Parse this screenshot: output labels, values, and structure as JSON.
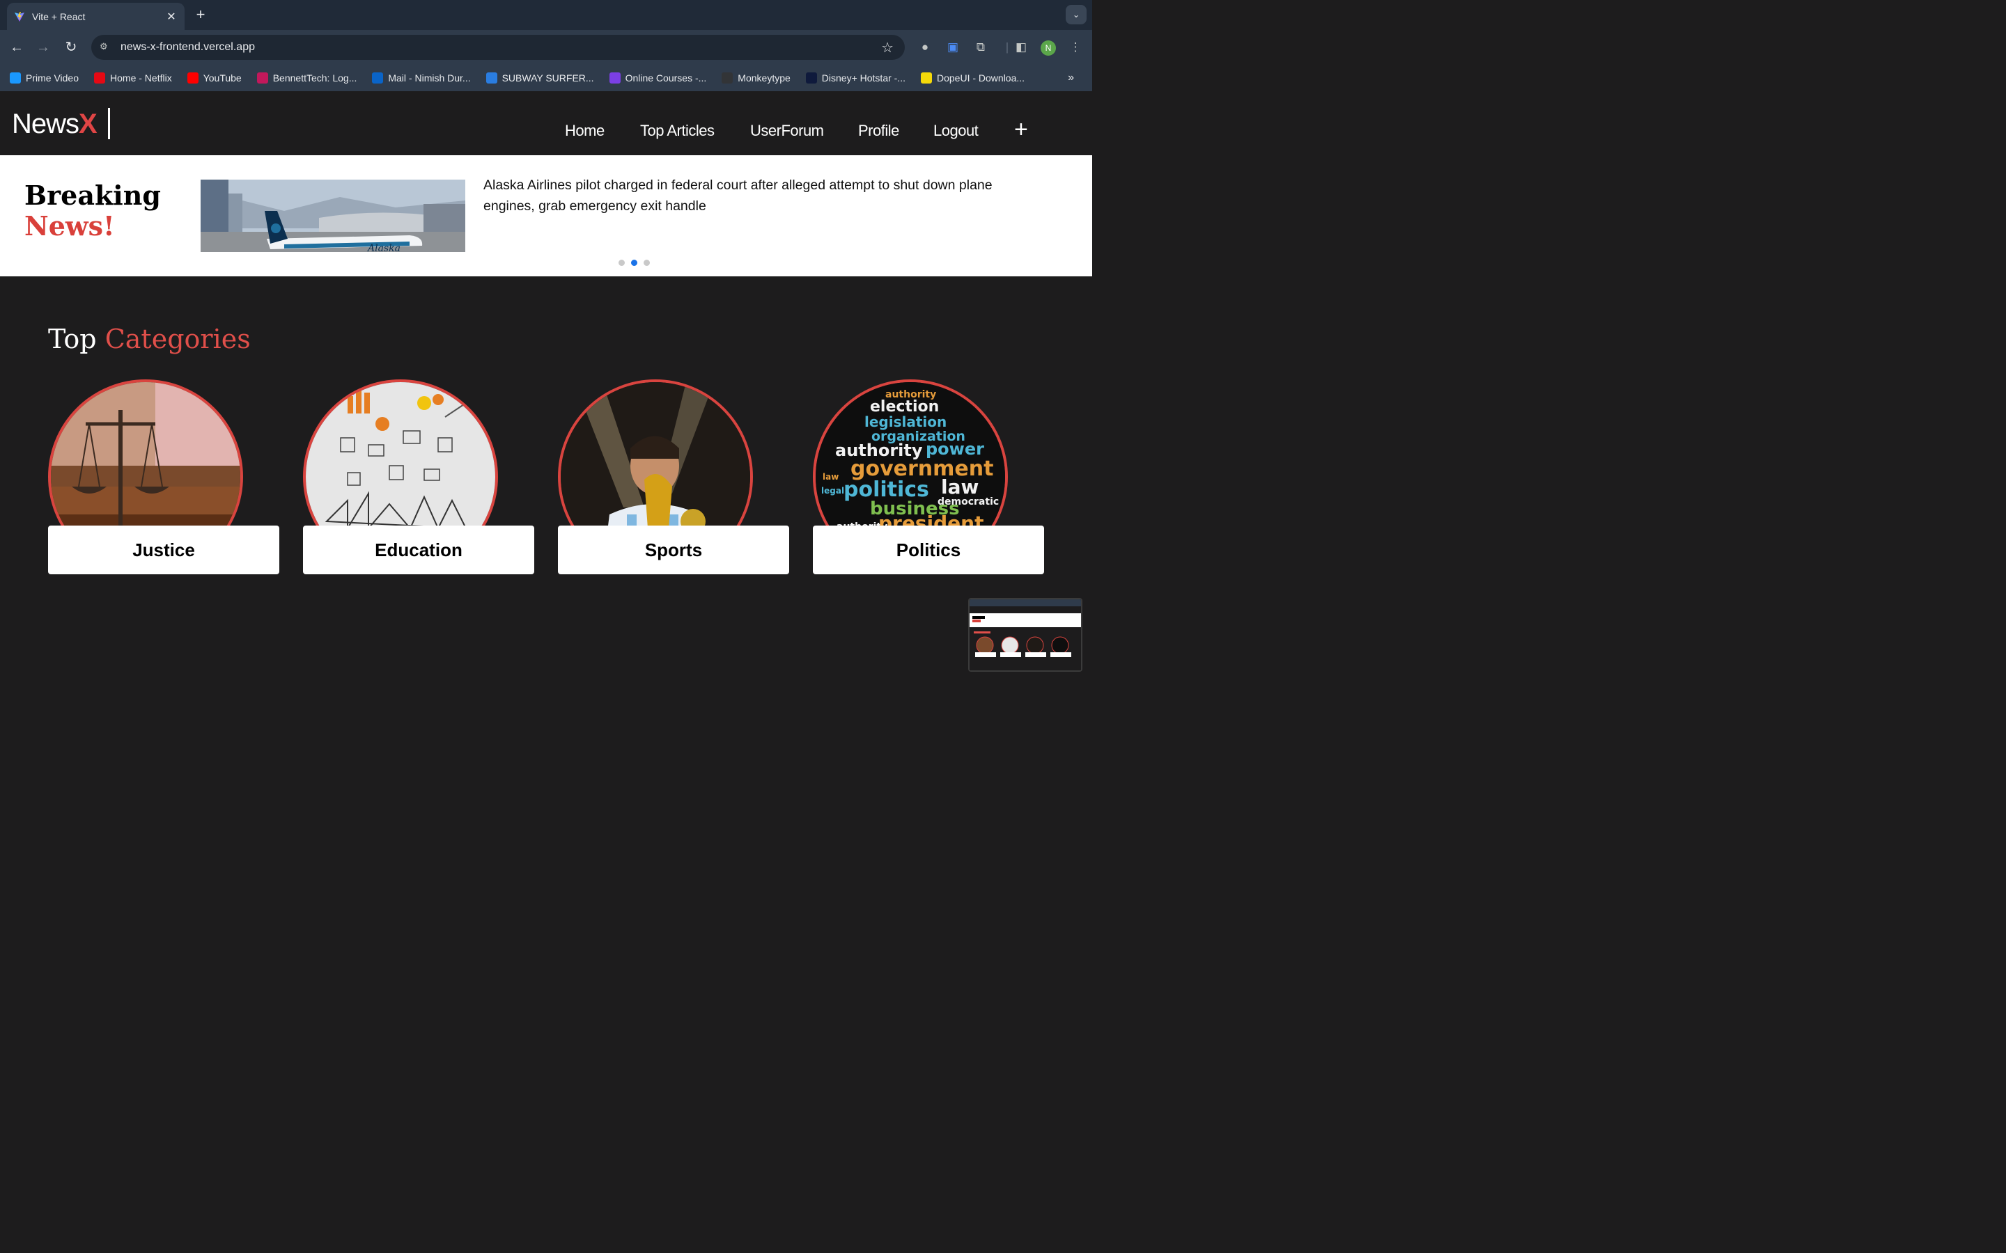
{
  "browser": {
    "tab_title": "Vite + React",
    "tab_close": "✕",
    "new_tab": "+",
    "url": "news-x-frontend.vercel.app",
    "profile_initial": "N",
    "bookmarks": [
      {
        "label": "Prime Video",
        "icon_color": "#1a98ff"
      },
      {
        "label": "Home - Netflix",
        "icon_color": "#e50914"
      },
      {
        "label": "YouTube",
        "icon_color": "#ff0000"
      },
      {
        "label": "BennettTech: Log...",
        "icon_color": "#c2185b"
      },
      {
        "label": "Mail - Nimish Dur...",
        "icon_color": "#0a64c8"
      },
      {
        "label": "SUBWAY SURFER...",
        "icon_color": "#2a7de1"
      },
      {
        "label": "Online Courses -...",
        "icon_color": "#7b3fe4"
      },
      {
        "label": "Monkeytype",
        "icon_color": "#323437"
      },
      {
        "label": "Disney+ Hotstar -...",
        "icon_color": "#0f1a3c"
      },
      {
        "label": "DopeUI - Downloa...",
        "icon_color": "#f5d90a"
      }
    ]
  },
  "site": {
    "logo_main": "News",
    "logo_accent": "X",
    "nav": [
      "Home",
      "Top Articles",
      "UserForum",
      "Profile",
      "Logout"
    ],
    "plus": "+"
  },
  "breaking": {
    "line1": "Breaking",
    "line2": "News!",
    "headline": "Alaska Airlines pilot charged in federal court after alleged attempt to shut down plane engines, grab emergency exit handle",
    "active_slide": 2,
    "slide_count": 3
  },
  "categories": {
    "heading_part1": "Top",
    "heading_part2": "Categories",
    "items": [
      "Justice",
      "Education",
      "Sports",
      "Politics"
    ]
  },
  "colors": {
    "accent_red": "#e04545",
    "header_bg": "#1d1c1d",
    "active_dot": "#1a73e8"
  }
}
